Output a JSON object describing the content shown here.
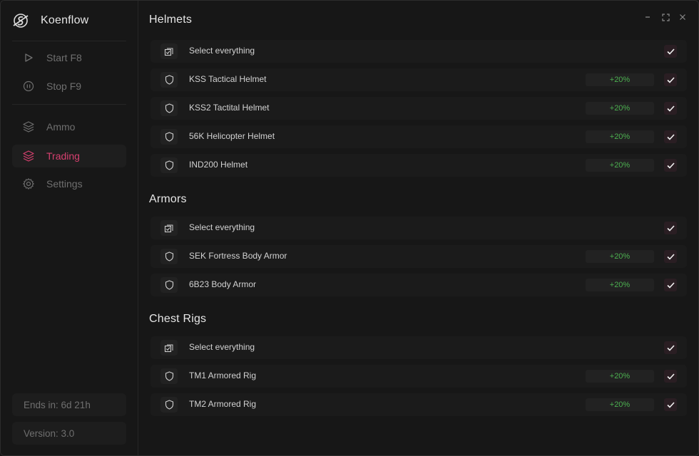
{
  "app": {
    "title": "Koenflow"
  },
  "sidebar": {
    "controls": [
      {
        "label": "Start F8",
        "icon": "play-icon"
      },
      {
        "label": "Stop F9",
        "icon": "pause-icon"
      }
    ],
    "nav": [
      {
        "label": "Ammo",
        "icon": "layers-icon",
        "active": false
      },
      {
        "label": "Trading",
        "icon": "layers-icon",
        "active": true
      },
      {
        "label": "Settings",
        "icon": "gear-icon",
        "active": false
      }
    ],
    "ends_in": "Ends in: 6d 21h",
    "version": "Version: 3.0"
  },
  "sections": [
    {
      "title": "Helmets",
      "select_all_label": "Select everything",
      "items": [
        {
          "label": "KSS Tactical Helmet",
          "badge": "+20%"
        },
        {
          "label": "KSS2 Tactital Helmet",
          "badge": "+20%"
        },
        {
          "label": "56K Helicopter Helmet",
          "badge": "+20%"
        },
        {
          "label": "IND200 Helmet",
          "badge": "+20%"
        }
      ]
    },
    {
      "title": "Armors",
      "select_all_label": "Select everything",
      "items": [
        {
          "label": "SEK Fortress Body Armor",
          "badge": "+20%"
        },
        {
          "label": "6B23 Body Armor",
          "badge": "+20%"
        }
      ]
    },
    {
      "title": "Chest Rigs",
      "select_all_label": "Select everything",
      "items": [
        {
          "label": "TM1 Armored Rig",
          "badge": "+20%"
        },
        {
          "label": "TM2 Armored Rig",
          "badge": "+20%"
        }
      ]
    }
  ],
  "colors": {
    "accent": "#d6406f",
    "badge_text": "#4caf50",
    "background": "#171717",
    "row": "#1b1b1b"
  }
}
